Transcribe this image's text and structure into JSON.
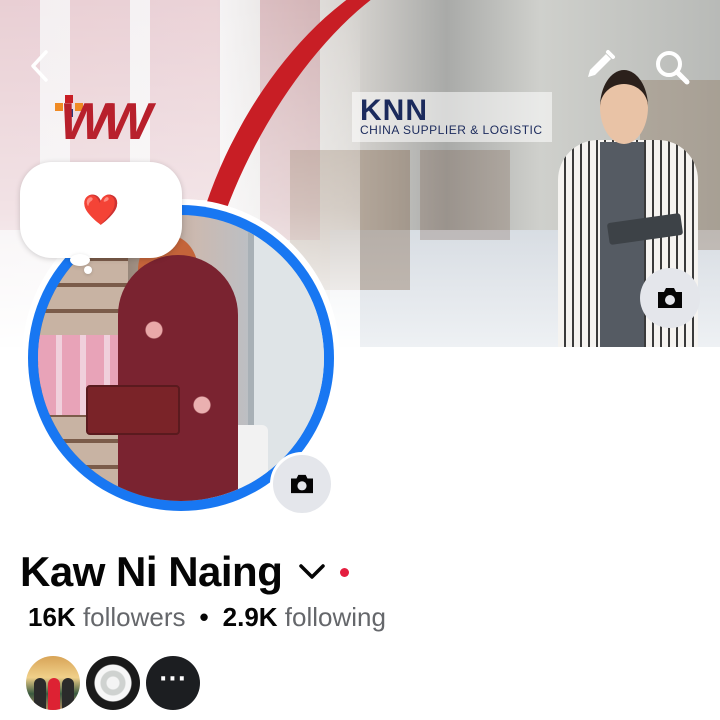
{
  "cover": {
    "brand_title": "KNN",
    "brand_subtitle": "CHINA SUPPLIER & LOGISTIC"
  },
  "note": {
    "text": "❤️"
  },
  "profile": {
    "name": "Kaw Ni Naing",
    "followers_count": "16K",
    "followers_label": "followers",
    "separator": "•",
    "following_count": "2.9K",
    "following_label": "following"
  },
  "mutuals": {
    "more_label": "···"
  },
  "icons": {
    "back": "chevron-left-icon",
    "edit": "pencil-icon",
    "search": "search-icon",
    "cover_camera": "camera-icon",
    "avatar_camera": "camera-icon",
    "name_dropdown": "chevron-down-icon",
    "status_dot": "red-dot-icon"
  },
  "colors": {
    "accent_blue": "#1877f2",
    "text_primary": "#050505",
    "text_secondary": "#65676b",
    "status_red": "#e41e3f",
    "brand_red": "#c81e25",
    "brand_navy": "#1b2a5c"
  }
}
